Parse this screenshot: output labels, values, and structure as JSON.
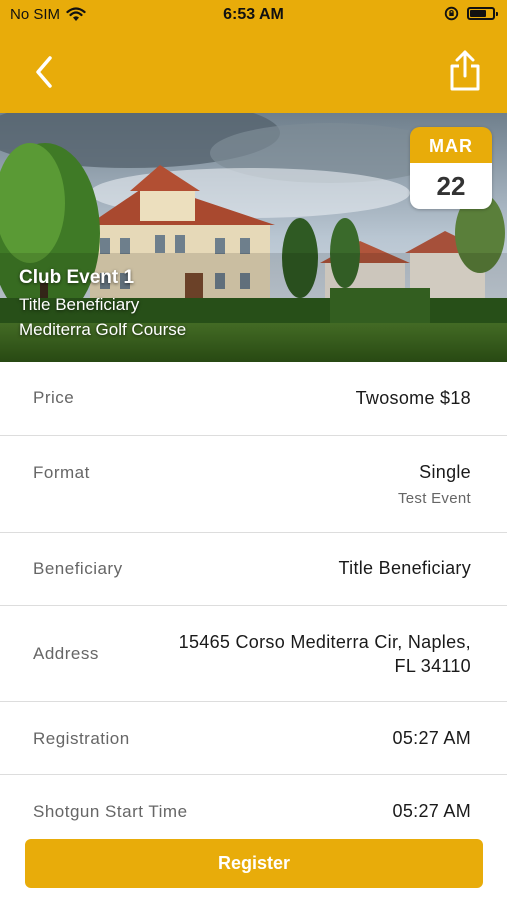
{
  "status": {
    "carrier": "No SIM",
    "time": "6:53 AM"
  },
  "nav": {
    "back_icon": "chevron-left-icon",
    "share_icon": "share-icon"
  },
  "event": {
    "title": "Club Event 1",
    "beneficiary": "Title Beneficiary",
    "course": "Mediterra Golf Course",
    "date_month": "MAR",
    "date_day": "22"
  },
  "details": [
    {
      "label": "Price",
      "value": "Twosome $18",
      "sub": ""
    },
    {
      "label": "Format",
      "value": "Single",
      "sub": "Test Event"
    },
    {
      "label": "Beneficiary",
      "value": "Title Beneficiary",
      "sub": ""
    },
    {
      "label": "Address",
      "value_line1": "15465 Corso Mediterra Cir, Naples,",
      "value_line2": "FL 34110"
    },
    {
      "label": "Registration",
      "value": "05:27 AM"
    },
    {
      "label": "Shotgun Start Time",
      "value": "05:27 AM"
    }
  ],
  "actions": {
    "register_label": "Register"
  },
  "colors": {
    "accent": "#E8AC0A",
    "divider": "#dddddd",
    "label": "#666666"
  }
}
